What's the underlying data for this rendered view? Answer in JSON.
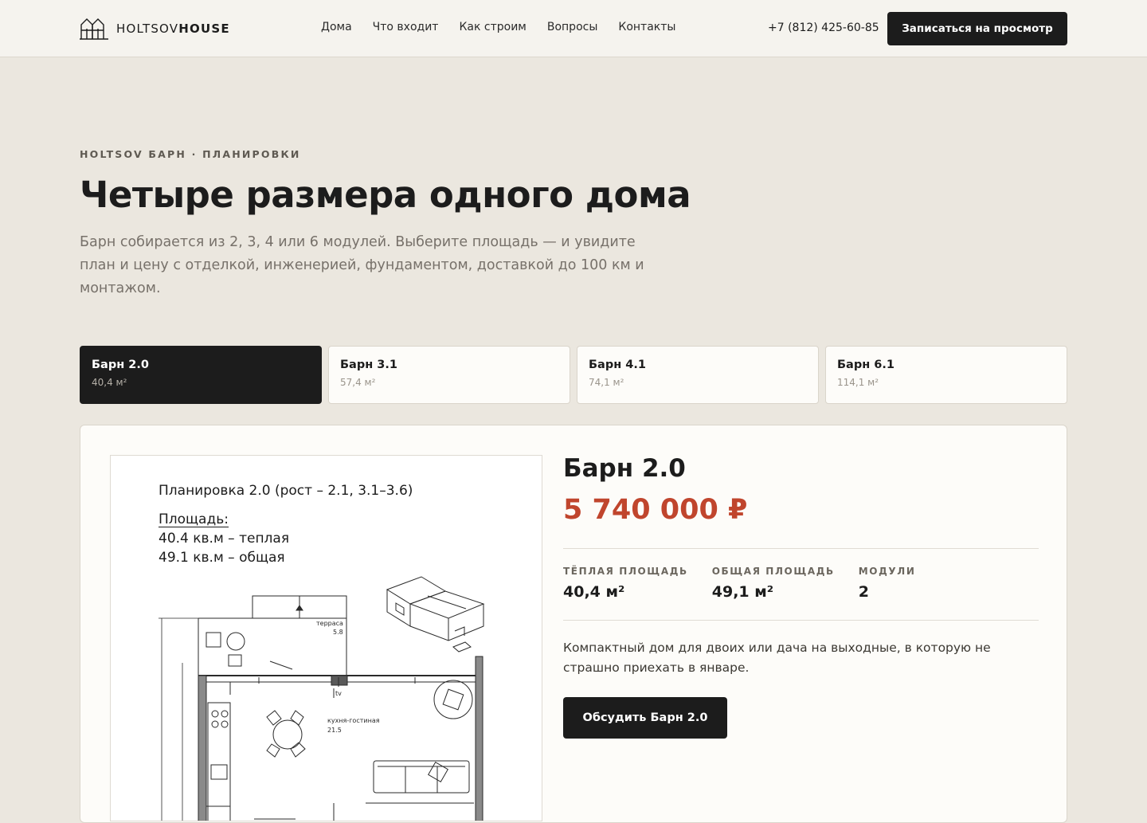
{
  "header": {
    "logo_light": "HOLTSOV",
    "logo_bold": "HOUSE",
    "nav": [
      "Дома",
      "Что входит",
      "Как строим",
      "Вопросы",
      "Контакты"
    ],
    "phone": "+7 (812) 425-60-85",
    "cta_label": "Записаться на просмотр"
  },
  "hero": {
    "eyebrow": "HOLTSOV БАРН · ПЛАНИРОВКИ",
    "title": "Четыре размера одного дома",
    "subtitle": "Барн собирается из 2, 3, 4 или 6 модулей. Выберите площадь — и увидите план и цену с отделкой, инженерией, фундаментом, доставкой до 100 км и монтажом."
  },
  "tabs": [
    {
      "name": "Барн 2.0",
      "area": "40,4 м²",
      "active": true
    },
    {
      "name": "Барн 3.1",
      "area": "57,4 м²",
      "active": false
    },
    {
      "name": "Барн 4.1",
      "area": "74,1 м²",
      "active": false
    },
    {
      "name": "Барн 6.1",
      "area": "114,1 м²",
      "active": false
    }
  ],
  "plan": {
    "title": "Планировка 2.0 (рост – 2.1, 3.1–3.6)",
    "area_label": "Площадь:",
    "warm": "40.4 кв.м – теплая",
    "total": "49.1 кв.м – общая",
    "terrace_label": "терраса",
    "terrace_value": "5.8",
    "tv_label": "tv",
    "kitchen_label": "кухня-гостиная",
    "kitchen_value": "21.5"
  },
  "detail": {
    "title": "Барн 2.0",
    "price": "5 740 000 ₽",
    "specs": [
      {
        "label": "ТЁПЛАЯ ПЛОЩАДЬ",
        "value": "40,4 м²"
      },
      {
        "label": "ОБЩАЯ ПЛОЩАДЬ",
        "value": "49,1 м²"
      },
      {
        "label": "МОДУЛИ",
        "value": "2"
      }
    ],
    "description": "Компактный дом для двоих или дача на выходные, в которую не страшно приехать в январе.",
    "button_label": "Обсудить Барн 2.0"
  },
  "colors": {
    "accent_price": "#c0452d",
    "dark": "#1c1c1c",
    "page_bg": "#ebe7df"
  },
  "icons": {
    "logo": "house-gable-logo-icon"
  }
}
